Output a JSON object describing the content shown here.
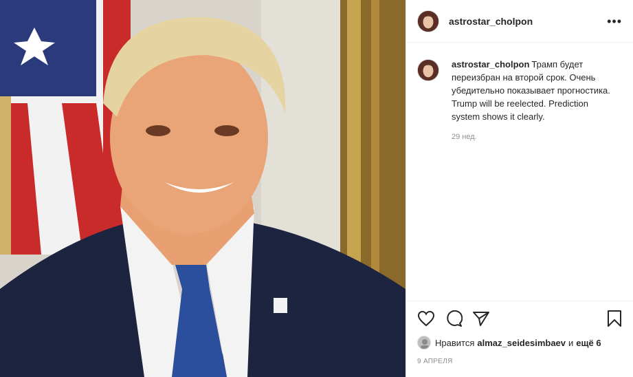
{
  "post": {
    "author": "astrostar_cholpon",
    "more_icon": "more-horizontal-icon",
    "caption_user": "astrostar_cholpon",
    "caption_text": "Трамп будет переизбран на второй срок. Очень убедительно показывает прогностика. Trump will be reelected. Prediction system shows it clearly.",
    "caption_time": "29 нед.",
    "likes_prefix": "Нравится",
    "likes_user": "almaz_seidesimbaev",
    "likes_and": "и",
    "likes_more": "ещё 6",
    "date": "9 АПРЕЛЯ"
  },
  "icons": [
    "heart-icon",
    "comment-icon",
    "share-icon",
    "bookmark-icon"
  ]
}
